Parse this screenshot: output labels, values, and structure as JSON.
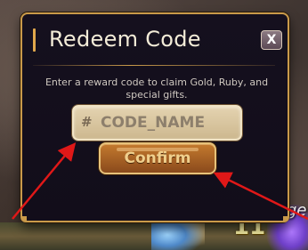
{
  "background": {
    "number_text": "11",
    "partial_word": "ge"
  },
  "dialog": {
    "title": "Redeem Code",
    "close_label": "X",
    "description": "Enter a reward code to claim Gold, Ruby, and special gifts.",
    "code_input": {
      "hash_symbol": "#",
      "placeholder": "CODE_NAME",
      "value": ""
    },
    "confirm_label": "Confirm"
  },
  "colors": {
    "panel_border": "#c99a4a",
    "panel_bg": "#15101e",
    "confirm_button": "#a8612a",
    "annotation_arrow": "#e01818"
  },
  "annotations": [
    {
      "name": "arrow-to-code-input",
      "color": "#e01818"
    },
    {
      "name": "arrow-to-confirm-button",
      "color": "#e01818"
    }
  ]
}
